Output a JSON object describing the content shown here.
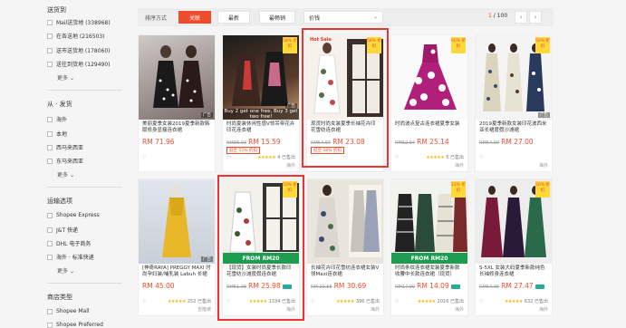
{
  "sidebar": {
    "sections": [
      {
        "heading": "送货到",
        "items": [
          "Mail送货地 (338968)",
          "在各送地 (216503)",
          "送市送货地 (178060)",
          "送往到货地 (129490)"
        ],
        "more": "更多"
      },
      {
        "heading": "从 · 发货",
        "items": [
          "海外",
          "本地",
          "西马来西亚",
          "东马来西亚"
        ],
        "more": "更多"
      },
      {
        "heading": "运输选项",
        "items": [
          "Shopee Express",
          "J&T 快递",
          "DHL 电子商务",
          "海外 · 标准快递"
        ],
        "more": "更多"
      },
      {
        "heading": "商店类型",
        "items": [
          "Shopee Mall",
          "Shopee Preferred"
        ],
        "more": ""
      }
    ]
  },
  "sortbar": {
    "label": "排序方式",
    "buttons": [
      "关联",
      "最新",
      "最畅销"
    ],
    "price_select": "价钱",
    "page_current": "1",
    "page_total": "/ 100",
    "prev": "‹",
    "next": "›"
  },
  "products": [
    {
      "title": "美丽夏季女装2019夏季新款韩版修身显瘦连衣裙",
      "old": "",
      "price": "RM 71.96",
      "badge": "",
      "sold": "",
      "loc": "",
      "disc": "",
      "ad": "广告",
      "banner": "",
      "stars": ""
    },
    {
      "title": "时尚夏装休闲性感V领吊带花卉印花连衣裙",
      "old": "RM36.93",
      "price": "RM 15.59",
      "badge": "低至 55% 折扣",
      "sold": "4 已售出",
      "loc": "海外",
      "disc": "58% 折扣",
      "ad": "广告",
      "banner": "Buy 2 get one free, Buy 3 get two free!",
      "stars": "★★★★★"
    },
    {
      "title": "现货时尚女装夏季长袖花卉印花雪纺连衣裙",
      "old": "RM54.97",
      "price": "RM 23.08",
      "badge": "低至 58% 折扣",
      "sold": "",
      "loc": "",
      "disc": "58% 折扣",
      "ad": "",
      "banner": "Hot Sale",
      "stars": ""
    },
    {
      "title": "时尚波点复古连衣裙夏季女装",
      "old": "RM62.94",
      "price": "RM 25.14",
      "badge": "",
      "sold": "5 已售出",
      "loc": "海外",
      "disc": "60% 折扣",
      "ad": "",
      "banner": "",
      "stars": "★★★★★"
    },
    {
      "title": "2019夏季新款女装印花波西米亚长裙度假沙滩裙",
      "old": "RM54.00",
      "price": "RM 27.00",
      "badge": "",
      "sold": "",
      "loc": "海外",
      "disc": "50% 折扣",
      "ad": "广告",
      "banner": "",
      "stars": ""
    },
    {
      "title": "[神奇RAYA] PREGGY MAXI 时尚孕妇装/哺乳装 Labuh 长裙",
      "old": "",
      "price": "RM 45.00",
      "badge": "",
      "sold": "252 已售出",
      "loc": "吉隆坡",
      "disc": "",
      "ad": "广告",
      "banner": "",
      "stars": "★★★★★"
    },
    {
      "title": "【现货】女装时尚夏季长款印花雪纺沙滩度假连衣裙",
      "old": "RM51.98",
      "price": "RM 25.98",
      "badge": "",
      "sold": "1334 已售出",
      "loc": "海外",
      "disc": "50% 折扣",
      "ad": "",
      "banner": "FROM RM20",
      "stars": "★★★★★"
    },
    {
      "title": "长袖花卉印花雪纺连衣裙女装V领Maxi连衣裙",
      "old": "RM 29.56",
      "price": "RM 30.69",
      "badge": "",
      "sold": "396 已售出",
      "loc": "海外",
      "disc": "",
      "ad": "",
      "banner": "",
      "stars": "★★★★★"
    },
    {
      "title": "时尚条纹连衣裙女装夏季新款收腰中长款连衣裙（现货）",
      "old": "RM17.99",
      "price": "RM 14.09",
      "badge": "",
      "sold": "2016 已售出",
      "loc": "海外",
      "disc": "22% 折扣",
      "ad": "",
      "banner": "FROM RM20",
      "stars": "★★★★★"
    },
    {
      "title": "S-5XL 女装大码夏季新款纯色长袖修身连衣裙",
      "old": "RM54.95",
      "price": "RM 27.47",
      "badge": "",
      "sold": "632 已售出",
      "loc": "海外",
      "disc": "50% 折扣",
      "ad": "",
      "banner": "",
      "stars": "★★★★★"
    }
  ],
  "colors": {
    "accent": "#ee4d2d",
    "highlight": "#e33333",
    "sale_green": "#1e9c52"
  }
}
